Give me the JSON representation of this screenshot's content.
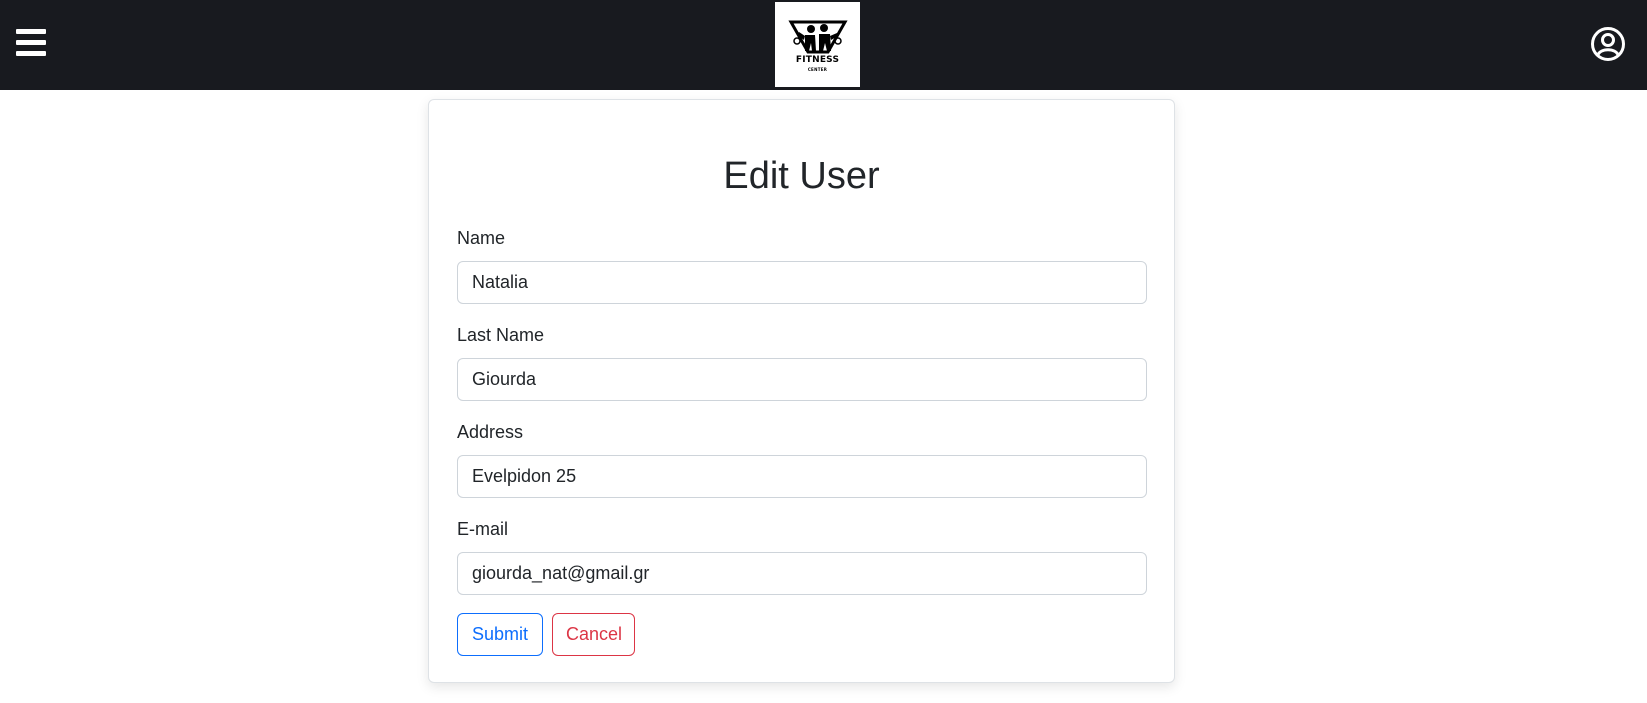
{
  "navbar": {
    "menu_icon": "hamburger-menu-icon",
    "logo": {
      "text": "FITNESS",
      "subtext": "CENTER"
    },
    "user_icon": "user-circle-icon"
  },
  "form": {
    "title": "Edit User",
    "fields": [
      {
        "label": "Name",
        "value": "Natalia"
      },
      {
        "label": "Last Name",
        "value": "Giourda"
      },
      {
        "label": "Address",
        "value": "Evelpidon 25"
      },
      {
        "label": "E-mail",
        "value": "giourda_nat@gmail.gr"
      }
    ],
    "submit_label": "Submit",
    "cancel_label": "Cancel"
  },
  "colors": {
    "navbar_bg": "#181a1f",
    "submit": "#0d6efd",
    "cancel": "#dc3545"
  }
}
